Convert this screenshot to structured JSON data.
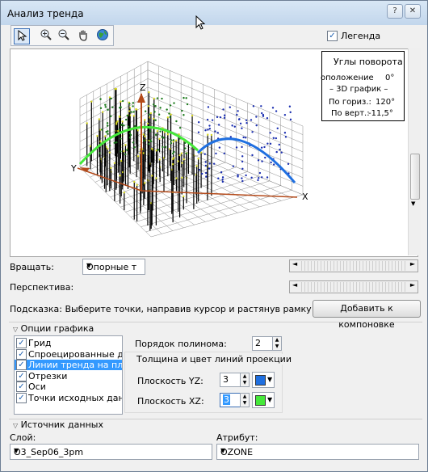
{
  "window": {
    "title": "Анализ тренда",
    "help_icon": "help-icon",
    "close_icon": "close-icon"
  },
  "toolbar": {
    "tools": [
      "select-arrow-icon",
      "zoom-in-icon",
      "zoom-out-icon",
      "pan-hand-icon",
      "globe-icon"
    ]
  },
  "legend_toggle": {
    "label": "Легенда",
    "checked": true
  },
  "plot": {
    "axis_z": "Z",
    "axis_y": "Y",
    "axis_x": "X",
    "colors": {
      "trend_yz": "#1f6fe0",
      "trend_xz": "#45e83a",
      "points_left": "#1a7a1a",
      "points_right": "#1b2fb0",
      "axes": "#b44a1a",
      "stems": "#000000",
      "grid": "#8c8c8c"
    }
  },
  "rotation_panel": {
    "title": "Углы поворота",
    "position_label": "оположение",
    "position_value": "0°",
    "graph_label": "– 3D график –",
    "horiz_label": "По гориз.:",
    "horiz_value": "120°",
    "vert_label": "По верт.:",
    "vert_value": "-11,5°"
  },
  "controls": {
    "rotate_label": "Вращать:",
    "rotate_value": "Опорные т",
    "perspective_label": "Перспектива:",
    "hint": "Подсказка: Выберите точки, направив курсор и растянув рамку",
    "add_button": "Добавить к компоновке"
  },
  "graph_options": {
    "section_title": "Опции графика",
    "items": [
      {
        "label": "Грид",
        "checked": true
      },
      {
        "label": "Спроецированные дан",
        "checked": true
      },
      {
        "label": "Линии тренда на плоск",
        "checked": true,
        "selected": true
      },
      {
        "label": "Отрезки",
        "checked": true
      },
      {
        "label": "Оси",
        "checked": true
      },
      {
        "label": "Точки исходных данны",
        "checked": true
      }
    ],
    "poly_label": "Порядок полинома:",
    "poly_value": "2",
    "proj_lines_label": "Толщина и цвет линий проекции",
    "yz_label": "Плоскость YZ:",
    "yz_value": "3",
    "yz_color": "#1f6fe0",
    "xz_label": "Плоскость XZ:",
    "xz_value": "3",
    "xz_color": "#45e83a"
  },
  "data_source": {
    "section_title": "Источник данных",
    "layer_label": "Слой:",
    "layer_value": "O3_Sep06_3pm",
    "attribute_label": "Атрибут:",
    "attribute_value": "OZONE"
  }
}
